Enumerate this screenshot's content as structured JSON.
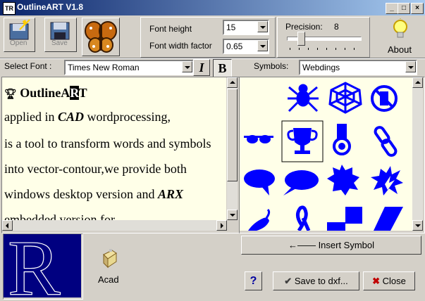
{
  "window": {
    "title": "OutlineART V1.8",
    "app_icon": "TR"
  },
  "toolbar": {
    "open_label": "Open",
    "save_label": "Save",
    "font_height_label": "Font height",
    "font_height_value": "15",
    "font_width_label": "Font width factor",
    "font_width_value": "0.65",
    "precision_label": "Precision:",
    "precision_value": "8",
    "about_label": "About"
  },
  "font_row": {
    "select_font_label": "Select Font :",
    "font_value": "Times New Roman",
    "italic_label": "I",
    "bold_label": "B",
    "symbols_label": "Symbols:",
    "symbols_value": "Webdings"
  },
  "editor": {
    "title_prefix": "Outline",
    "title_sel1": "A",
    "title_sel2": "R",
    "title_suffix": "T",
    "line1_a": "applied in ",
    "line1_b": "CAD",
    "line1_c": " wordprocessing,",
    "line2": "is a tool to transform words and symbols",
    "line3": "into vector-contour,we provide both",
    "line4_a": "windows desktop version and ",
    "line4_b": "ARX",
    "line5": "embedded version for"
  },
  "symbols": {
    "items": [
      "spider-icon",
      "web-icon",
      "no-phone-icon",
      "sunglasses-icon",
      "trophy-icon",
      "medal-icon",
      "chain-link-icon",
      "speech-bubble-left-icon",
      "speech-bubble-right-icon",
      "starburst-icon",
      "explosion-icon",
      "pepper-icon",
      "ribbon-icon",
      "checker-icon",
      "parallelogram-icon"
    ],
    "selected": "trophy-icon"
  },
  "preview": {
    "letter": "R",
    "acad_label": "Acad"
  },
  "buttons": {
    "insert_symbol": "Insert Symbol",
    "help": "?",
    "save_dxf": "Save to dxf...",
    "close": "Close"
  },
  "colors": {
    "symbol_blue": "#0000ff",
    "preview_bg": "#000080",
    "editor_bg": "#ffffe8",
    "title_blue": "#0a246a"
  }
}
